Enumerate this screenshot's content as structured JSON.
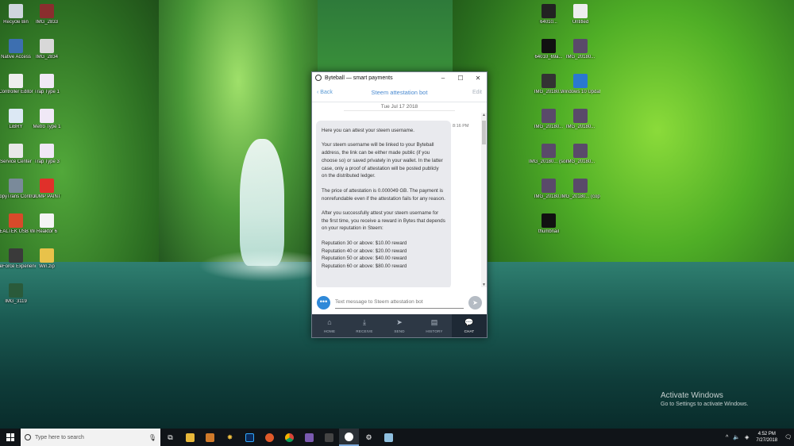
{
  "desktop_left": [
    {
      "label": "Recycle Bin",
      "color": "#cfd6de"
    },
    {
      "label": "IMG_2833",
      "color": "#8a2e2e"
    },
    {
      "label": "Native Access",
      "color": "#3d6fb0"
    },
    {
      "label": "IMG_2834",
      "color": "#d8d8d8"
    },
    {
      "label": "Controller Editor",
      "color": "#eeeeee"
    },
    {
      "label": "Trap Type 1",
      "color": "#f0e8f6"
    },
    {
      "label": "LiBRY",
      "color": "#dce8f4"
    },
    {
      "label": "Metro Type 1",
      "color": "#f0e8f6"
    },
    {
      "label": "Service Center",
      "color": "#e8e8e8"
    },
    {
      "label": "Trap Type 3",
      "color": "#f0e8f6"
    },
    {
      "label": "CopyTrans Control...",
      "color": "#7a8a9a"
    },
    {
      "label": "JUMP PAINT",
      "color": "#e0302a"
    },
    {
      "label": "REALTEK USB Wireless LA...",
      "color": "#d84a2a"
    },
    {
      "label": "Reaktor 6",
      "color": "#f4f4f4"
    },
    {
      "label": "GeForce Experience",
      "color": "#3a3a3a"
    },
    {
      "label": "Win.zip",
      "color": "#e8c24a"
    },
    {
      "label": "IMG_3119",
      "color": "#2a5a3a"
    }
  ],
  "desktop_right": [
    {
      "label": "64010...",
      "color": "#222222"
    },
    {
      "label": "Untitled",
      "color": "#eeeeee"
    },
    {
      "label": "64010_69a...",
      "color": "#111111"
    },
    {
      "label": "IMG_20180...",
      "color": "#5a4a6a"
    },
    {
      "label": "IMG_20180...",
      "color": "#333333"
    },
    {
      "label": "Windows 10 Update As...",
      "color": "#2a78d0"
    },
    {
      "label": "IMG_20180...",
      "color": "#5a4a6a"
    },
    {
      "label": "IMG_20180...",
      "color": "#5a4a6a"
    },
    {
      "label": "IMG_20180... (sorted)",
      "color": "#5a4a6a"
    },
    {
      "label": "IMG_20180...",
      "color": "#5a4a6a"
    },
    {
      "label": "IMG_20180...",
      "color": "#5a4a6a"
    },
    {
      "label": "IMG_20180... (copy)",
      "color": "#5a4a6a"
    },
    {
      "label": "thumbnail",
      "color": "#111111"
    }
  ],
  "window": {
    "title": "Byteball — smart payments",
    "nav": {
      "back": "Back",
      "title": "Steem attestation bot",
      "edit": "Edit"
    },
    "date": "Tue Jul 17 2018",
    "message_time": "8:16 PM",
    "message_paragraphs": [
      "Here you can attest your steem username.",
      "Your steem username will be linked to your Byteball address, the link can be either made public (if you choose so) or saved privately in your wallet. In the latter case, only a proof of attestation will be posted publicly on the distributed ledger.",
      "The price of attestation is 0.000049 GB. The payment is nonrefundable even if the attestation fails for any reason.",
      "After you successfully attest your steem username for the first time, you receive a reward in Bytes that depends on your reputation in Steem:"
    ],
    "rewards": [
      "Reputation 30 or above: $10.00 reward",
      "Reputation 40 or above: $20.00 reward",
      "Reputation 50 or above: $40.00 reward",
      "Reputation 60 or above: $80.00 reward"
    ],
    "composer_placeholder": "Text message to Steem attestation bot",
    "tabs": [
      {
        "label": "HOME",
        "icon": "⌂"
      },
      {
        "label": "RECEIVE",
        "icon": "⤓"
      },
      {
        "label": "SEND",
        "icon": "➤"
      },
      {
        "label": "HISTORY",
        "icon": "▤"
      },
      {
        "label": "CHAT",
        "icon": "💬"
      }
    ]
  },
  "watermark": {
    "title": "Activate Windows",
    "subtitle": "Go to Settings to activate Windows."
  },
  "taskbar": {
    "search_placeholder": "Type here to search",
    "time": "4:52 PM",
    "date": "7/27/2018"
  }
}
